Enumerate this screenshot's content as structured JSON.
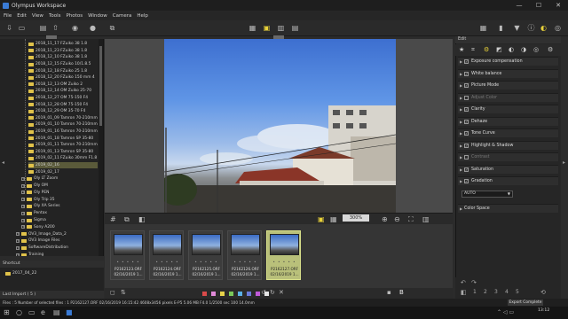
{
  "window": {
    "title": "Olympus Workspace",
    "min": "—",
    "max": "☐",
    "close": "✕"
  },
  "menu": [
    "File",
    "Edit",
    "View",
    "Tools",
    "Photos",
    "Window",
    "Camera",
    "Help"
  ],
  "tree": {
    "folders": [
      "2018_11_17 FZuiko 38 1.8",
      "2018_11_23 FZuiko 38 1.8",
      "2018_12_10 FZuiko 38 1.8",
      "2018_12_15 FZuiko 10/1.8.5",
      "2018_12_18 FZuiko 25 1.8",
      "2018_12_20 FZuiko 150 mm 4",
      "2018_12_13 OM Zuiko 2",
      "2018_12_14 OM Zuiko 25-70",
      "2018_12_27 OM 75-150 F4",
      "2018_12_28 OM 75-150 F4",
      "2018_12_29 OM 35-70 F4",
      "2019_01_09 Tamron 70-210mm",
      "2019_01_10 Tamron 70-210mm",
      "2019_01_16 Tamron 70-210mm",
      "2019_01_18 Tamron SP 35-80",
      "2019_01_11 Tamron 70-210mm",
      "2019_01_13 Tamron SP 35-80",
      "2019_02_11 FZuiko 30mm F1.8",
      "2019_02_16",
      "2019_02_17"
    ],
    "groups": [
      "Oly LT Zoom",
      "Oly OM",
      "Oly PEN",
      "Oly Trip 35",
      "Oly XA Series",
      "Pentax",
      "Sigma",
      "Sony A200",
      "OV3_Image_Data_2",
      "OV3 Image Files",
      "SoftwareDistribution",
      "Training"
    ]
  },
  "shortcut": {
    "title": "Shortcut",
    "item": "2017_04_22"
  },
  "last_import": "Last Import ( 5 )",
  "zoom": "300%",
  "thumbnails": [
    {
      "file": "P2162123.ORF",
      "date": "02/16/2019 1..."
    },
    {
      "file": "P2162124.ORF",
      "date": "02/16/2019 1..."
    },
    {
      "file": "P2162125.ORF",
      "date": "02/16/2019 1..."
    },
    {
      "file": "P2162126.ORF",
      "date": "02/16/2019 1..."
    },
    {
      "file": "P2162127.ORF",
      "date": "02/16/2019 1..."
    }
  ],
  "edit_panel": {
    "title": "Edit",
    "sections": [
      {
        "label": "Exposure compensation",
        "checked": true,
        "dim": false
      },
      {
        "label": "White balance",
        "checked": true,
        "dim": false
      },
      {
        "label": "Picture Mode",
        "checked": true,
        "dim": false
      },
      {
        "label": "Adjust Color",
        "checked": false,
        "dim": true
      },
      {
        "label": "Clarity",
        "checked": true,
        "dim": false
      },
      {
        "label": "Dehaze",
        "checked": true,
        "dim": false
      },
      {
        "label": "Tone Curve",
        "checked": true,
        "dim": false
      },
      {
        "label": "Highlight & Shadow",
        "checked": true,
        "dim": false
      },
      {
        "label": "Contrast",
        "checked": false,
        "dim": true
      },
      {
        "label": "Saturation",
        "checked": true,
        "dim": false
      },
      {
        "label": "Gradation",
        "checked": true,
        "dim": false
      }
    ],
    "gradation_value": "AUTO",
    "color_space": "Color Space"
  },
  "status": {
    "text": "Files : 5  Number of selected files : 1   P2162127.ORF  02/16/2019 16:15:42  4608x3456 pixels  E-P5  5.06 MB  F4.0  1/2500 sec  100  14.0mm",
    "export": "Export Complete"
  },
  "clock": {
    "time": "13:12",
    "date": "..."
  }
}
